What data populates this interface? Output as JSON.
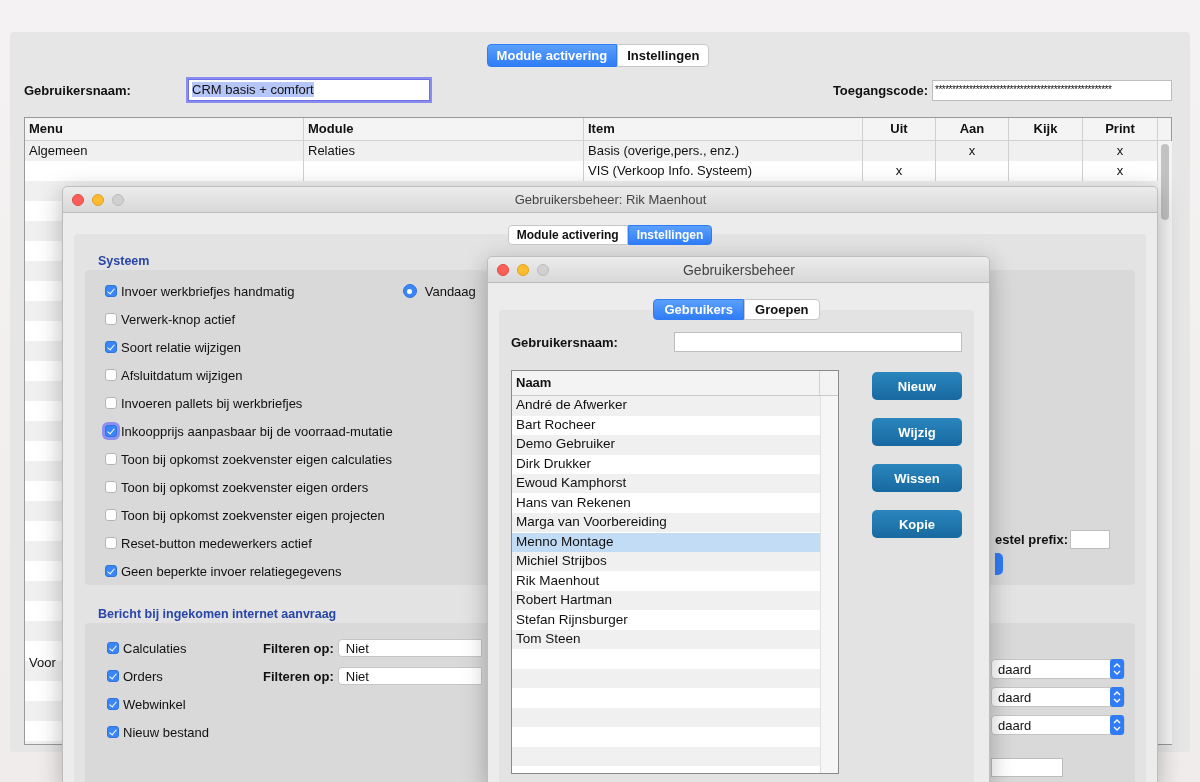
{
  "back_window": {
    "tabs": [
      {
        "label": "Module activering",
        "selected": true
      },
      {
        "label": "Instellingen",
        "selected": false
      }
    ],
    "username": {
      "label": "Gebruikersnaam:",
      "value": "CRM basis + comfort",
      "focused": true
    },
    "access_code": {
      "label": "Toegangscode:",
      "value": "****************************************************"
    },
    "table": {
      "columns": [
        "Menu",
        "Module",
        "Item",
        "Uit",
        "Aan",
        "Kijk",
        "Print"
      ],
      "rows": [
        {
          "cells": [
            "Algemeen",
            "Relaties",
            "Basis (overige,pers., enz.)",
            "",
            "x",
            "",
            "x"
          ]
        },
        {
          "cells": [
            "",
            "",
            "VIS (Verkoop Info. Systeem)",
            "x",
            "",
            "",
            "x"
          ]
        },
        {
          "cells": [
            "Voor",
            "",
            "",
            "",
            "",
            "",
            ""
          ]
        }
      ]
    }
  },
  "settings_window": {
    "title": "Gebruikersbeheer: Rik Maenhout",
    "tabs": [
      {
        "label": "Module activering",
        "selected": false
      },
      {
        "label": "Instellingen",
        "selected": true
      }
    ],
    "system": {
      "heading": "Systeem",
      "options": [
        {
          "label": "Invoer werkbriefjes handmatig",
          "checked": true,
          "focused": false
        },
        {
          "label": "Verwerk-knop actief",
          "checked": false,
          "focused": false
        },
        {
          "label": "Soort relatie wijzigen",
          "checked": true,
          "focused": false
        },
        {
          "label": "Afsluitdatum wijzigen",
          "checked": false,
          "focused": false
        },
        {
          "label": "Invoeren pallets bij werkbriefjes",
          "checked": false,
          "focused": false
        },
        {
          "label": "Inkoopprijs aanpasbaar bij de voorraad-mutatie",
          "checked": true,
          "focused": true
        },
        {
          "label": "Toon bij opkomst zoekvenster eigen calculaties",
          "checked": false,
          "focused": false
        },
        {
          "label": "Toon bij opkomst zoekvenster eigen orders",
          "checked": false,
          "focused": false
        },
        {
          "label": "Toon bij opkomst zoekvenster eigen projecten",
          "checked": false,
          "focused": false
        },
        {
          "label": "Reset-button medewerkers actief",
          "checked": false,
          "focused": false
        },
        {
          "label": "Geen beperkte invoer relatiegegevens",
          "checked": true,
          "focused": false
        }
      ],
      "radio": {
        "label": "Vandaag",
        "selected": true
      },
      "prefix_label": "estel prefix:"
    },
    "incoming": {
      "heading": "Bericht bij ingekomen internet aanvraag",
      "options": [
        {
          "label": "Calculaties",
          "checked": true,
          "filter_label": "Filteren op:",
          "filter_value": "Niet"
        },
        {
          "label": "Orders",
          "checked": true,
          "filter_label": "Filteren op:",
          "filter_value": "Niet"
        },
        {
          "label": "Webwinkel",
          "checked": true
        },
        {
          "label": "Nieuw bestand",
          "checked": true
        }
      ],
      "selects": [
        "daard",
        "daard",
        "daard"
      ]
    }
  },
  "users_window": {
    "title": "Gebruikersbeheer",
    "tabs": [
      {
        "label": "Gebruikers",
        "selected": true
      },
      {
        "label": "Groepen",
        "selected": false
      }
    ],
    "username": {
      "label": "Gebruikersnaam:"
    },
    "list": {
      "column": "Naam",
      "items": [
        {
          "name": "André de Afwerker",
          "selected": false
        },
        {
          "name": "Bart Rocheer",
          "selected": false
        },
        {
          "name": "Demo Gebruiker",
          "selected": false
        },
        {
          "name": "Dirk Drukker",
          "selected": false
        },
        {
          "name": "Ewoud Kamphorst",
          "selected": false
        },
        {
          "name": "Hans van Rekenen",
          "selected": false
        },
        {
          "name": "Marga van Voorbereiding",
          "selected": false
        },
        {
          "name": "Menno Montage",
          "selected": true
        },
        {
          "name": "Michiel Strijbos",
          "selected": false
        },
        {
          "name": "Rik Maenhout",
          "selected": false
        },
        {
          "name": "Robert Hartman",
          "selected": false
        },
        {
          "name": "Stefan Rijnsburger",
          "selected": false
        },
        {
          "name": "Tom Steen",
          "selected": false
        }
      ]
    },
    "buttons": [
      "Nieuw",
      "Wijzig",
      "Wissen",
      "Kopie"
    ]
  }
}
